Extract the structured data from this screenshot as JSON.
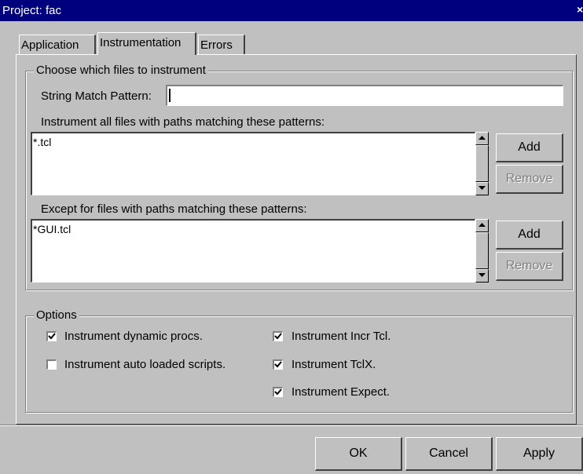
{
  "window": {
    "title": "Project: fac",
    "close_glyph": "×"
  },
  "tabs": [
    {
      "label": "Application",
      "active": false
    },
    {
      "label": "Instrumentation",
      "active": true
    },
    {
      "label": "Errors",
      "active": false
    }
  ],
  "files_group": {
    "legend": "Choose which files to instrument",
    "pattern_label": "String Match Pattern:",
    "pattern_value": "",
    "include_label": "Instrument all files with paths matching these patterns:",
    "include_items": [
      "*.tcl"
    ],
    "exclude_label": "Except for files with paths matching these patterns:",
    "exclude_items": [
      "*GUI.tcl"
    ],
    "add_label": "Add",
    "remove_label": "Remove"
  },
  "options_group": {
    "legend": "Options",
    "items": [
      {
        "label": "Instrument dynamic procs.",
        "checked": true
      },
      {
        "label": "Instrument auto loaded scripts.",
        "checked": false
      },
      {
        "label": "Instrument Incr Tcl.",
        "checked": true
      },
      {
        "label": "Instrument TclX.",
        "checked": true
      },
      {
        "label": "Instrument Expect.",
        "checked": true
      }
    ]
  },
  "buttons": {
    "ok": "OK",
    "cancel": "Cancel",
    "apply": "Apply"
  }
}
